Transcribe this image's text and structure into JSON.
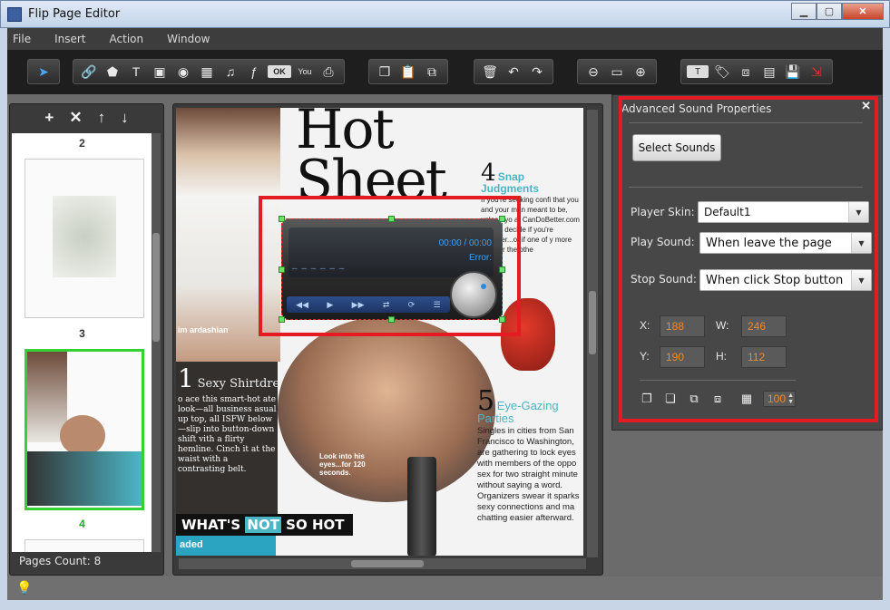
{
  "window": {
    "title": "Flip Page Editor"
  },
  "menu": [
    "File",
    "Insert",
    "Action",
    "Window"
  ],
  "left_panel": {
    "tools": [
      "+",
      "✕",
      "↑",
      "↓"
    ],
    "pages": [
      "2",
      "3",
      "4"
    ],
    "pages_count": "Pages Count: 8"
  },
  "magazine": {
    "title_line1": "Hot",
    "title_line2": "Sheet",
    "col1_num": "4",
    "col1_head": "Snap Judgments",
    "col1_text": "If you're seeking confi that you and your man meant to be, upload yo at CanDoBetter.com people decide if you're together...or if one of y more cute for the othe",
    "sexy_num": "1",
    "sexy_head": "Sexy Shirtdresses",
    "sexy_text": "o ace this smart-hot ate look—all business asual up top, all ISFW below—slip into button-down shift vith a flirty hemline. Cinch it at the waist with a contrasting belt.",
    "eye_num": "5",
    "eye_head": "Eye-Gazing Parties",
    "eye_text": "Singles in cities from San Francisco to Washington, are gathering to lock eyes with members of the oppo sex for two straight minute without saying a word. Organizers swear it sparks sexy connections and ma chatting easier afterward.",
    "caption": "Look into his eyes...for 120 seconds.",
    "name_caption": "im ardashian",
    "bottom_banner_a": "WHAT'S ",
    "bottom_banner_hl": "NOT",
    "bottom_banner_b": " SO HOT",
    "bottom_sub": "aded"
  },
  "player": {
    "time": "00:00 / 00:00",
    "error": "Error:",
    "dashes": "– – – – – –"
  },
  "sound_props": {
    "title": "Advanced Sound Properties",
    "select_button": "Select Sounds",
    "player_skin_label": "Player Skin:",
    "player_skin_value": "Default1",
    "play_sound_label": "Play Sound:",
    "play_sound_value": "When leave the page",
    "stop_sound_label": "Stop Sound:",
    "stop_sound_value": "When click Stop button",
    "x_label": "X:",
    "x_value": "188",
    "w_label": "W:",
    "w_value": "246",
    "y_label": "Y:",
    "y_value": "190",
    "h_label": "H:",
    "h_value": "112",
    "opacity_value": "100"
  },
  "colors": {
    "highlight_red": "#e41b23",
    "accent_orange": "#f08a2a",
    "selection_green": "#35d035"
  }
}
